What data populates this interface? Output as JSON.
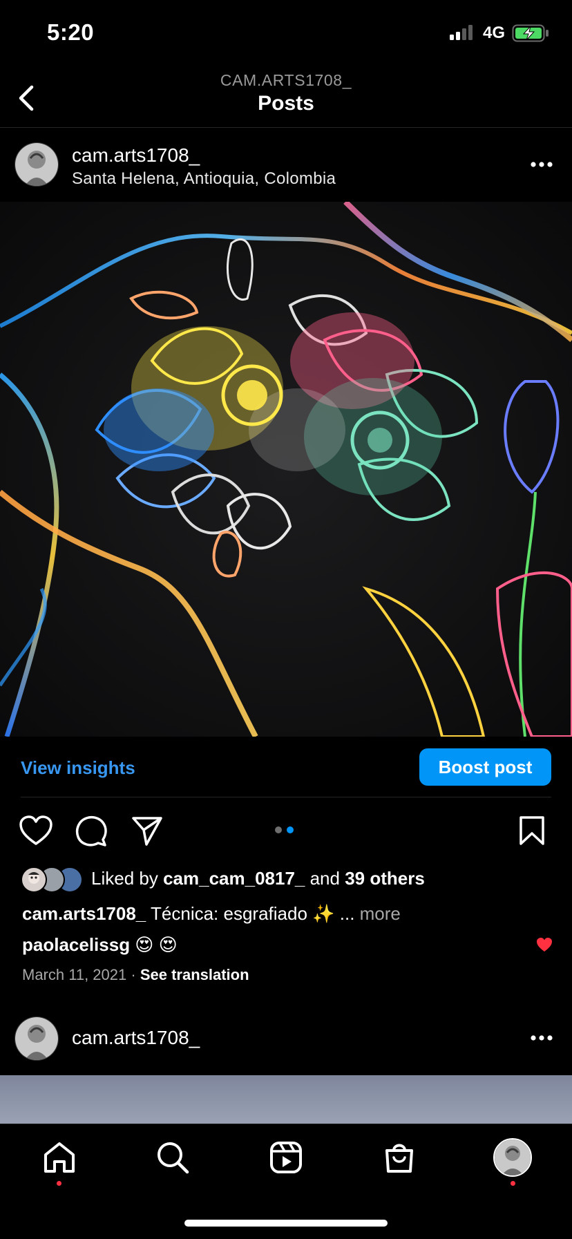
{
  "status_bar": {
    "time": "5:20",
    "network": "4G",
    "signal_icon": "signal-bars-icon",
    "battery_icon": "battery-charging-icon"
  },
  "header": {
    "subtitle": "CAM.ARTS1708_",
    "title": "Posts",
    "back_icon": "chevron-left-icon"
  },
  "post": {
    "username": "cam.arts1708_",
    "location": "Santa Helena, Antioquia, Colombia",
    "more_icon": "more-horizontal-icon",
    "image_description_icon": "chalk-flower-artwork",
    "view_insights_label": "View insights",
    "boost_label": "Boost post",
    "carousel": {
      "count": 2,
      "active_index": 2
    },
    "likes": {
      "prefix": "Liked by ",
      "user": "cam_cam_0817_",
      "middle": " and ",
      "others": "39 others"
    },
    "caption": {
      "user": "cam.arts1708_",
      "text": " Técnica: esgrafiado ✨ ... ",
      "more": "more"
    },
    "comment": {
      "user": "paolacelissg",
      "text": " 😍 😍"
    },
    "date": "March 11, 2021",
    "date_separator": " · ",
    "see_translation": "See translation"
  },
  "next_post": {
    "username": "cam.arts1708_"
  },
  "colors": {
    "accent": "#0095f6",
    "link": "#3897f0",
    "like_red": "#ff3040",
    "muted": "#a8a8a8"
  }
}
